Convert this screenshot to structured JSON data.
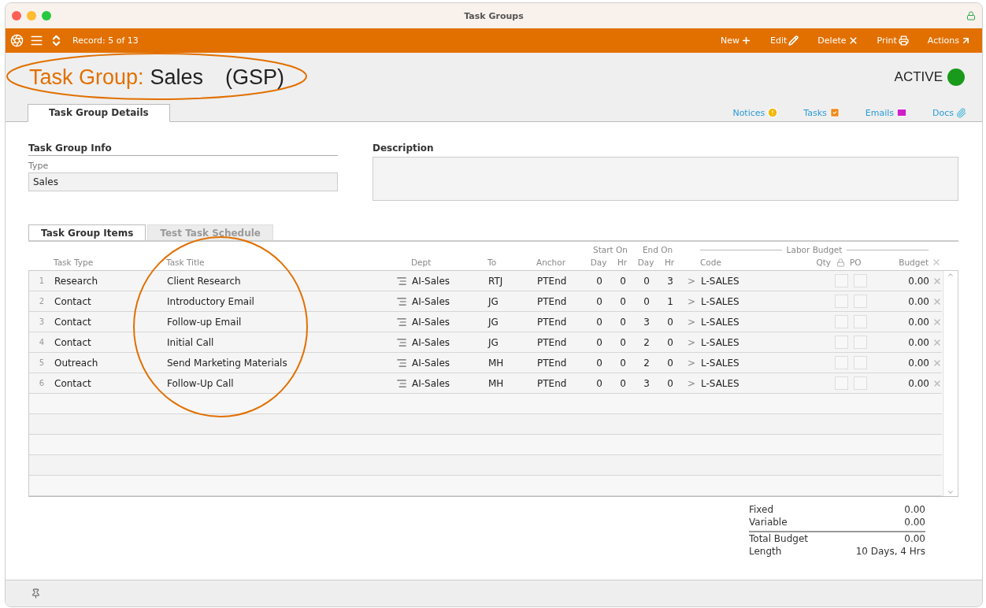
{
  "window": {
    "title": "Task Groups",
    "locked": true
  },
  "toolbar": {
    "record": "Record: 5 of 13",
    "actions": [
      {
        "label": "New",
        "kind": "new"
      },
      {
        "label": "Edit",
        "kind": "edit"
      },
      {
        "label": "Delete",
        "kind": "delete"
      },
      {
        "label": "Print",
        "kind": "print"
      },
      {
        "label": "Actions",
        "kind": "actions"
      }
    ]
  },
  "header": {
    "label": "Task Group:",
    "name": "Sales",
    "code": "(GSP)",
    "status": "ACTIVE"
  },
  "tabs": [
    {
      "label": "Task Group Details",
      "selected": true
    }
  ],
  "links": [
    {
      "label": "Notices",
      "kind": "notices"
    },
    {
      "label": "Tasks",
      "kind": "tasks"
    },
    {
      "label": "Emails",
      "kind": "emails"
    },
    {
      "label": "Docs",
      "kind": "docs"
    }
  ],
  "info": {
    "title": "Task Group Info",
    "type_label": "Type",
    "type_value": "Sales"
  },
  "description": {
    "title": "Description"
  },
  "item_tabs": [
    {
      "label": "Task Group Items",
      "selected": true,
      "disabled": false
    },
    {
      "label": "Test Task Schedule",
      "selected": false,
      "disabled": true
    }
  ],
  "table": {
    "groups": {
      "start": "Start On",
      "end": "End On",
      "labor": "Labor Budget"
    },
    "columns": [
      "Task Type",
      "Task Title",
      "Dept",
      "To",
      "Anchor",
      "Day",
      "Hr",
      "Day",
      "Hr",
      "Code",
      "Qty",
      "PO",
      "Budget"
    ],
    "rows": [
      {
        "num": "1",
        "type": "Research",
        "title": "Client Research",
        "dept": "AI-Sales",
        "to": "RTJ",
        "anchor": "PTEnd",
        "start_day": "0",
        "start_hr": "0",
        "end_day": "0",
        "end_hr": "3",
        "arrow": ">",
        "code": "L-SALES",
        "locked": false,
        "po": false,
        "budget": "0.00"
      },
      {
        "num": "2",
        "type": "Contact",
        "title": "Introductory Email",
        "dept": "AI-Sales",
        "to": "JG",
        "anchor": "PTEnd",
        "start_day": "0",
        "start_hr": "0",
        "end_day": "0",
        "end_hr": "1",
        "arrow": ">",
        "code": "L-SALES",
        "locked": false,
        "po": false,
        "budget": "0.00"
      },
      {
        "num": "3",
        "type": "Contact",
        "title": "Follow-up Email",
        "dept": "AI-Sales",
        "to": "JG",
        "anchor": "PTEnd",
        "start_day": "0",
        "start_hr": "0",
        "end_day": "3",
        "end_hr": "0",
        "arrow": ">",
        "code": "L-SALES",
        "locked": false,
        "po": false,
        "budget": "0.00"
      },
      {
        "num": "4",
        "type": "Contact",
        "title": "Initial Call",
        "dept": "AI-Sales",
        "to": "JG",
        "anchor": "PTEnd",
        "start_day": "0",
        "start_hr": "0",
        "end_day": "2",
        "end_hr": "0",
        "arrow": ">",
        "code": "L-SALES",
        "locked": false,
        "po": false,
        "budget": "0.00"
      },
      {
        "num": "5",
        "type": "Outreach",
        "title": "Send Marketing Materials",
        "dept": "AI-Sales",
        "to": "MH",
        "anchor": "PTEnd",
        "start_day": "0",
        "start_hr": "0",
        "end_day": "2",
        "end_hr": "0",
        "arrow": ">",
        "code": "L-SALES",
        "locked": false,
        "po": false,
        "budget": "0.00"
      },
      {
        "num": "6",
        "type": "Contact",
        "title": "Follow-Up Call",
        "dept": "AI-Sales",
        "to": "MH",
        "anchor": "PTEnd",
        "start_day": "0",
        "start_hr": "0",
        "end_day": "3",
        "end_hr": "0",
        "arrow": ">",
        "code": "L-SALES",
        "locked": false,
        "po": false,
        "budget": "0.00"
      }
    ]
  },
  "totals": [
    {
      "label": "Fixed",
      "value": "0.00"
    },
    {
      "label": "Variable",
      "value": "0.00"
    },
    {
      "label": "Total Budget",
      "value": "0.00"
    },
    {
      "label": "Length",
      "value": "10 Days, 4 Hrs"
    }
  ]
}
